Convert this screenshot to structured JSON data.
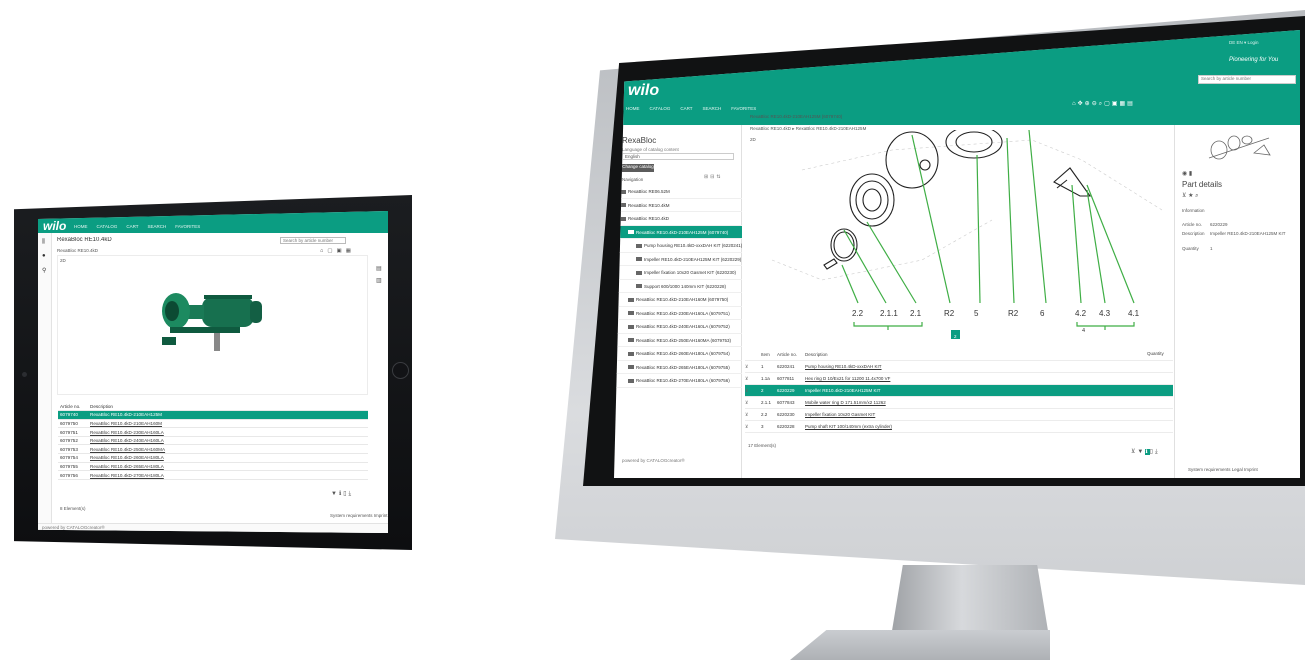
{
  "tablet": {
    "logo": "wilo",
    "nav": [
      "HOME",
      "CATALOG",
      "CART",
      "SEARCH",
      "FAVORITES"
    ],
    "search_placeholder": "Search by article number",
    "title": "RexaBloc RE10.4kD",
    "breadcrumb": "RexaBloc RE10.4kD",
    "view_label": "2D",
    "table": {
      "headers": [
        "Article no.",
        "Description"
      ],
      "rows": [
        [
          "6079740",
          "RexaBloc RE10.4kD-210EAH125M",
          true
        ],
        [
          "6079750",
          "RexaBloc RE10.4kD-210EAH160M",
          false
        ],
        [
          "6079751",
          "RexaBloc RE10.4kD-230EAH160LA",
          false
        ],
        [
          "6079752",
          "RexaBloc RE10.4kD-240EAH160LA",
          false
        ],
        [
          "6079753",
          "RexaBloc RE10.4kD-250EAH160MA",
          false
        ],
        [
          "6079754",
          "RexaBloc RE10.4kD-260EAH180LA",
          false
        ],
        [
          "6079755",
          "RexaBloc RE10.4kD-265EAH180LA",
          false
        ],
        [
          "6079756",
          "RexaBloc RE10.4kD-270EAH180LA",
          false
        ]
      ]
    },
    "elements": "8 Element(s)",
    "footer": "powered by CATALOGcreator®",
    "system_req": "System requirements  Imprint"
  },
  "monitor": {
    "logo": "wilo",
    "top_links": "DE  EN  ▾ Login",
    "slogan": "Pioneering for You",
    "search_placeholder": "Search by article number",
    "nav": [
      "HOME",
      "CATALOG",
      "CART",
      "SEARCH",
      "FAVORITES"
    ],
    "breadcrumb": "RexaBloc RE10.4kD-210EAH125M (6079740)",
    "breadcrumb2": "RexaBloc RE10.4kD ▸ RexaBloc RE10.4kD-210EAH125M",
    "catalog_title": "RexaBloc",
    "language_label": "Language of catalog content",
    "language": "English",
    "change_btn": "Change catalog",
    "navigation": "Navigation",
    "tree": [
      {
        "label": "RexaBloc RE06.52M",
        "level": 0,
        "sel": false
      },
      {
        "label": "RexaBloc RE10.4kM",
        "level": 0,
        "sel": false
      },
      {
        "label": "RexaBloc RE10.4kD",
        "level": 0,
        "sel": false
      },
      {
        "label": "RexaBloc RE10.4kD-210EAH125M (6079740)",
        "level": 1,
        "sel": true
      },
      {
        "label": "Pump housing RE10.4kD-xxxDAH KIT (6220241)",
        "level": 2,
        "sel": false
      },
      {
        "label": "Impeller RE10.4kD-210EAH125M KIT (6220229)",
        "level": 2,
        "sel": false
      },
      {
        "label": "Impeller fixation 10x20 Gasmet KIT (6220230)",
        "level": 2,
        "sel": false
      },
      {
        "label": "Support 600/1000 140mm KIT (6220228)",
        "level": 2,
        "sel": false
      },
      {
        "label": "RexaBloc RE10.4kD-210EAH160M (6079750)",
        "level": 1,
        "sel": false
      },
      {
        "label": "RexaBloc RE10.4kD-230EAH160LA (6079751)",
        "level": 1,
        "sel": false
      },
      {
        "label": "RexaBloc RE10.4kD-240EAH160LA (6079752)",
        "level": 1,
        "sel": false
      },
      {
        "label": "RexaBloc RE10.4kD-250EAH160MA (6079753)",
        "level": 1,
        "sel": false
      },
      {
        "label": "RexaBloc RE10.4kD-260EAH180LA (6079754)",
        "level": 1,
        "sel": false
      },
      {
        "label": "RexaBloc RE10.4kD-265EAH180LA (6079755)",
        "level": 1,
        "sel": false
      },
      {
        "label": "RexaBloc RE10.4kD-270EAH180LA (6079756)",
        "level": 1,
        "sel": false
      }
    ],
    "view_label": "2D",
    "callouts": [
      "2.2",
      "2.1.1",
      "2.1",
      "R2",
      "5",
      "R2",
      "6",
      "4.2",
      "4.3",
      "4.1"
    ],
    "group_badge": "2",
    "group_label": "4",
    "table": {
      "headers": [
        "Item",
        "Article no.",
        "Description",
        "Quantity"
      ],
      "rows": [
        [
          "1",
          "6220241",
          "Pump housing RE10.4kD-xxxDAH KIT",
          "",
          false
        ],
        [
          "1.1a",
          "6077811",
          "Hex ring D 10/Ex21 for 11200 11.4x700 VF",
          "",
          false
        ],
        [
          "2",
          "6220229",
          "Impeller RE10.4kD-210EAH125M KIT",
          "",
          true
        ],
        [
          "2.1.1",
          "6077843",
          "Mobile water ring D 171.51mm/x2 11262",
          "",
          false
        ],
        [
          "2.2",
          "6220230",
          "Impeller fixation 10x20 Gasmet KIT",
          "",
          false
        ],
        [
          "3",
          "6220228",
          "Pump shaft KIT 100/140mm (extra cylinder)",
          "",
          false
        ]
      ]
    },
    "elements": "17 Element(s)",
    "part_details": "Part details",
    "information": "Information",
    "article_no_label": "Article no.",
    "article_no": "6220229",
    "description_label": "Description",
    "description": "Impeller RE10.4kD-210EAH125M KIT",
    "quantity_label": "Quantity",
    "quantity": "1",
    "footer": "powered by CATALOGcreator®",
    "system_req": "System requirements  Legal  Imprint"
  },
  "colors": {
    "accent": "#0b9d82",
    "selection": "#0b9d82"
  }
}
